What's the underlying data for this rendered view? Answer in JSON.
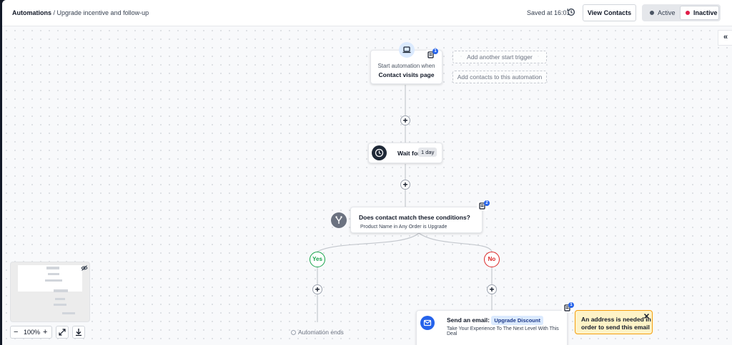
{
  "header": {
    "breadcrumb_root": "Automations",
    "breadcrumb_separator": " / ",
    "breadcrumb_current": "Upgrade incentive and follow-up",
    "saved_text": "Saved at 16:01",
    "view_contacts_label": "View Contacts",
    "status_options": [
      {
        "label": "Active",
        "color": "#4b5563",
        "selected": false
      },
      {
        "label": "Inactive",
        "color": "#e11d48",
        "selected": true
      }
    ]
  },
  "trigger": {
    "prefix": "Start automation when",
    "title": "Contact visits page",
    "note_count": "1",
    "icon": "laptop-icon"
  },
  "add_trigger_label": "Add another start trigger",
  "add_contacts_label": "Add contacts to this automation",
  "wait": {
    "label": "Wait for",
    "value": "1 day",
    "icon": "clock-icon"
  },
  "condition": {
    "title": "Does contact match these conditions?",
    "detail": "Product Name in Any Order is Upgrade",
    "note_count": "2",
    "icon": "split-icon"
  },
  "branches": {
    "yes_label": "Yes",
    "no_label": "No",
    "yes_color": "#16a34a",
    "no_color": "#dc2626"
  },
  "automation_ends_label": "Automation ends",
  "email_action": {
    "prefix": "Send an email:",
    "campaign": "Upgrade Discount",
    "subject": "Take Your Experience To The Next Level With This Deal",
    "note_count": "1",
    "icon": "mail-icon"
  },
  "warning": {
    "text_line1": "An address is needed in",
    "text_line2": "order to send this email",
    "close_icon": "close-icon"
  },
  "zoom": {
    "level": "100%"
  },
  "colors": {
    "accent": "#2563eb",
    "warning_bg": "#fef3c7",
    "warning_border": "#f59e0b"
  }
}
